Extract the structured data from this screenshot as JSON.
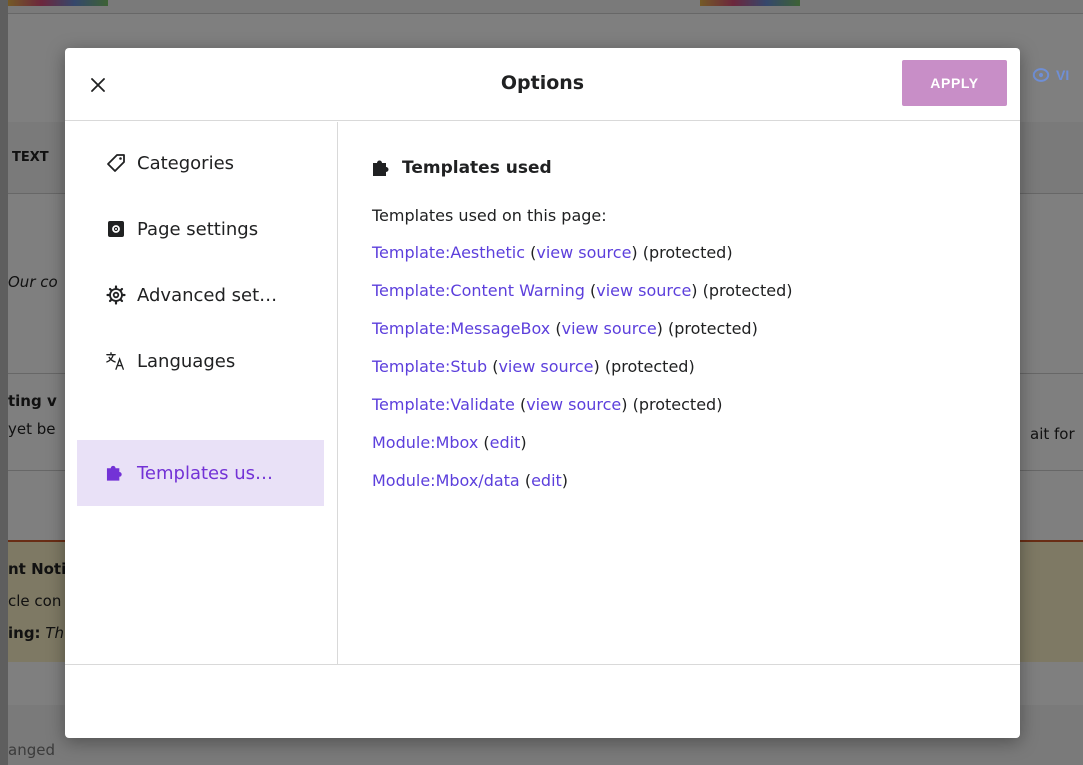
{
  "background": {
    "toolbar_text": "TEXT",
    "line_italic": "Our co",
    "line_bold_1": "ting v",
    "line_2": "yet be",
    "line_right": "ait for",
    "notice_bold": "nt Noti",
    "notice_line": "cle con",
    "notice_warn_bold": "ing:",
    "notice_warn_italic": "Th",
    "bottom_text": "anged",
    "visual_label": "VI"
  },
  "dialog": {
    "title": "Options",
    "apply_label": "APPLY",
    "sidebar": {
      "items": [
        {
          "label": "Categories",
          "icon": "tag-icon"
        },
        {
          "label": "Page settings",
          "icon": "page-settings-icon"
        },
        {
          "label": "Advanced set…",
          "icon": "gear-icon"
        },
        {
          "label": "Languages",
          "icon": "language-icon"
        },
        {
          "label": "Templates us…",
          "icon": "puzzle-icon",
          "selected": true
        }
      ]
    },
    "main": {
      "heading": "Templates used",
      "intro": "Templates used on this page:",
      "templates": [
        {
          "name": "Template:Aesthetic",
          "action": "view source",
          "status": "(protected)"
        },
        {
          "name": "Template:Content Warning",
          "action": "view source",
          "status": "(protected)"
        },
        {
          "name": "Template:MessageBox",
          "action": "view source",
          "status": "(protected)"
        },
        {
          "name": "Template:Stub",
          "action": "view source",
          "status": "(protected)"
        },
        {
          "name": "Template:Validate",
          "action": "view source",
          "status": "(protected)"
        },
        {
          "name": "Module:Mbox",
          "action": "edit",
          "status": ""
        },
        {
          "name": "Module:Mbox/data",
          "action": "edit",
          "status": ""
        }
      ]
    }
  },
  "colors": {
    "accent": "#7332d6",
    "link": "#5c3fdc",
    "apply_button": "#c88ec7",
    "selected_bg": "#e9e1f7"
  }
}
